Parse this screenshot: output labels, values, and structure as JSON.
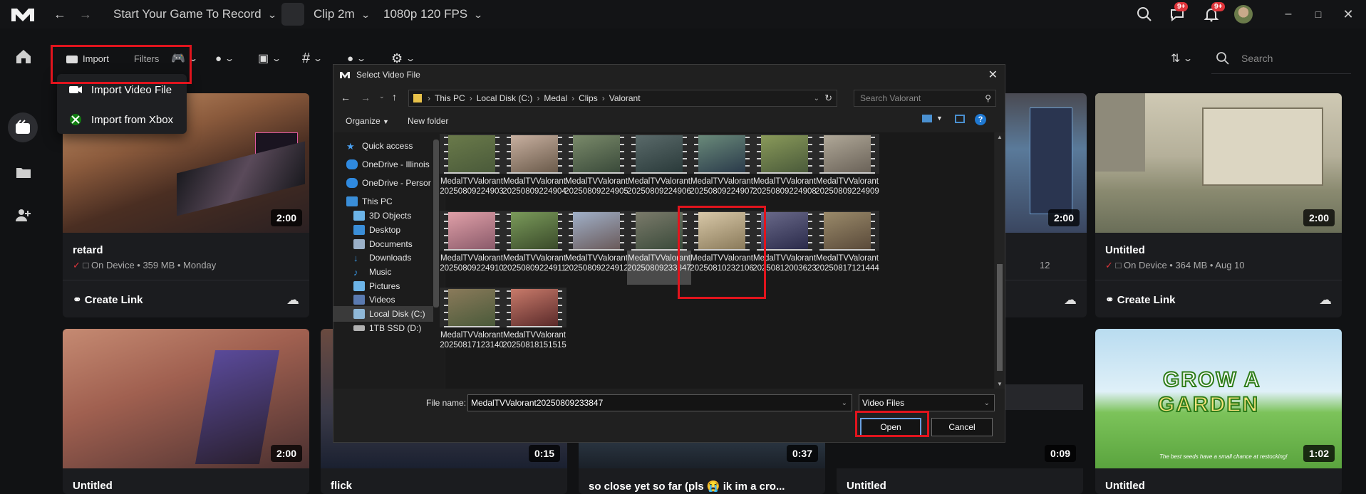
{
  "topbar": {
    "game_select": "Start Your Game To Record",
    "clip_length": "Clip 2m",
    "quality": "1080p 120 FPS",
    "badge_friends": "9+",
    "badge_notifications": "9+"
  },
  "filters": {
    "import_label": "Import",
    "filters_label": "Filters",
    "search_placeholder": "Search"
  },
  "import_menu": {
    "items": [
      "Import Video File",
      "Import from Xbox"
    ]
  },
  "cards": [
    {
      "title": "retard",
      "meta": "On Device • 359 MB • Monday",
      "duration": "2:00",
      "link": "Create Link"
    },
    {
      "title": "Untitled",
      "meta": "On Device • 364 MB • Aug 10",
      "duration": "2:00",
      "link": "Create Link"
    },
    {
      "title": "Untitled",
      "duration": "2:00"
    },
    {
      "title": "flick",
      "duration": "0:15"
    },
    {
      "title": "so close yet so far (pls 😭 ik im a cro...",
      "duration": "0:37"
    },
    {
      "title": "Untitled",
      "duration": "0:09"
    },
    {
      "title": "Untitled",
      "duration": "1:02"
    }
  ],
  "partial_card": {
    "duration": "2:00",
    "meta_suffix": "12"
  },
  "garden_text": {
    "line1": "GROW A",
    "line2": "GARDEN",
    "caption": "The best seeds have a small chance at restocking!"
  },
  "dialog": {
    "title": "Select Video File",
    "path": [
      "This PC",
      "Local Disk (C:)",
      "Medal",
      "Clips",
      "Valorant"
    ],
    "search_placeholder": "Search Valorant",
    "organize": "Organize",
    "new_folder": "New folder",
    "nav": [
      "Quick access",
      "OneDrive - Illinois",
      "OneDrive - Persor",
      "This PC",
      "3D Objects",
      "Desktop",
      "Documents",
      "Downloads",
      "Music",
      "Pictures",
      "Videos",
      "Local Disk (C:)",
      "1TB SSD (D:)"
    ],
    "files": [
      {
        "l1": "MedalTVValorant",
        "l2": "20250809224903"
      },
      {
        "l1": "MedalTVValorant",
        "l2": "20250809224904"
      },
      {
        "l1": "MedalTVValorant",
        "l2": "20250809224905"
      },
      {
        "l1": "MedalTVValorant",
        "l2": "20250809224906"
      },
      {
        "l1": "MedalTVValorant",
        "l2": "20250809224907"
      },
      {
        "l1": "MedalTVValorant",
        "l2": "20250809224908"
      },
      {
        "l1": "MedalTVValorant",
        "l2": "20250809224909"
      },
      {
        "l1": "MedalTVValorant",
        "l2": "20250809224910"
      },
      {
        "l1": "MedalTVValorant",
        "l2": "20250809224911"
      },
      {
        "l1": "MedalTVValorant",
        "l2": "20250809224912"
      },
      {
        "l1": "MedalTVValorant",
        "l2": "20250809233847"
      },
      {
        "l1": "MedalTVValorant",
        "l2": "20250810232106"
      },
      {
        "l1": "MedalTVValorant",
        "l2": "20250812003623"
      },
      {
        "l1": "MedalTVValorant",
        "l2": "20250817121444"
      },
      {
        "l1": "MedalTVValorant",
        "l2": "20250817123140"
      },
      {
        "l1": "MedalTVValorant",
        "l2": "20250818151515"
      }
    ],
    "file_name_label": "File name:",
    "file_name_value": "MedalTVValorant20250809233847",
    "file_type": "Video Files",
    "open": "Open",
    "cancel": "Cancel"
  },
  "colors": {
    "accent_red": "#e1141d",
    "dialog_bg": "#202020"
  }
}
